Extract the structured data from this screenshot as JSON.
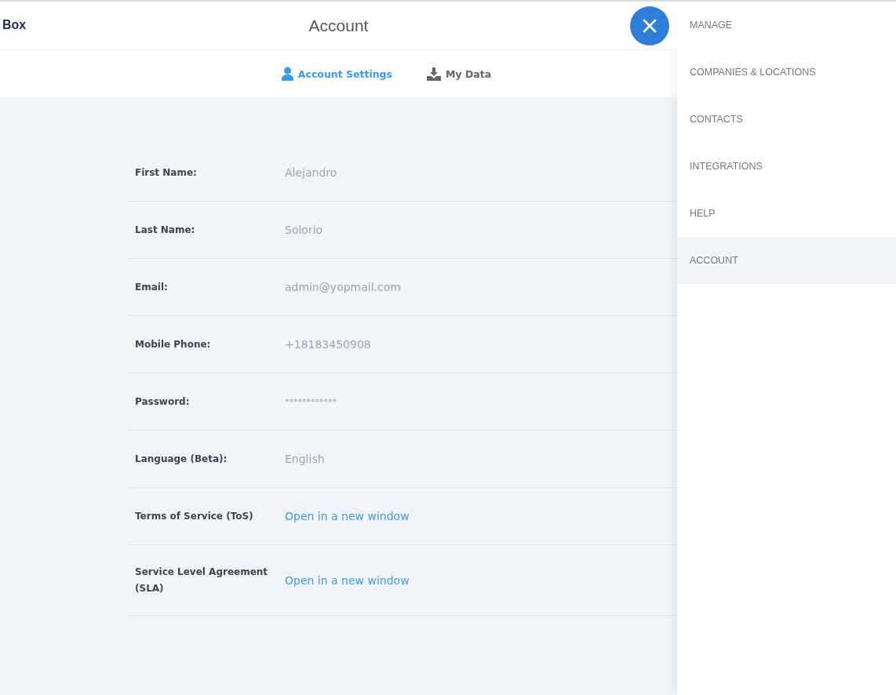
{
  "header": {
    "logo": "Box",
    "title": "Account"
  },
  "tabs": [
    {
      "label": "Account Settings",
      "kind": "user",
      "selected": true
    },
    {
      "label": "My Data",
      "kind": "download",
      "selected": false
    }
  ],
  "fields": [
    {
      "label": "First Name:",
      "value": "Alejandro",
      "kind": "text"
    },
    {
      "label": "Last Name:",
      "value": "Solorio",
      "kind": "text"
    },
    {
      "label": "Email:",
      "value": "admin@yopmail.com",
      "kind": "text"
    },
    {
      "label": "Mobile Phone:",
      "value": "+18183450908",
      "kind": "text"
    },
    {
      "label": "Password:",
      "value": "************",
      "kind": "password"
    },
    {
      "label": "Language (Beta):",
      "value": "English",
      "kind": "text"
    },
    {
      "label": "Terms of Service (ToS)",
      "value": "Open in a new window",
      "kind": "link"
    },
    {
      "label": "Service Level Agreement (SLA)",
      "value": "Open in a new window",
      "kind": "link"
    }
  ],
  "sidebar": {
    "items": [
      {
        "label": "MANAGE",
        "selected": false
      },
      {
        "label": "COMPANIES & LOCATIONS",
        "selected": false
      },
      {
        "label": "CONTACTS",
        "selected": false
      },
      {
        "label": "INTEGRATIONS",
        "selected": false
      },
      {
        "label": "HELP",
        "selected": false
      },
      {
        "label": "ACCOUNT",
        "selected": true
      }
    ]
  }
}
